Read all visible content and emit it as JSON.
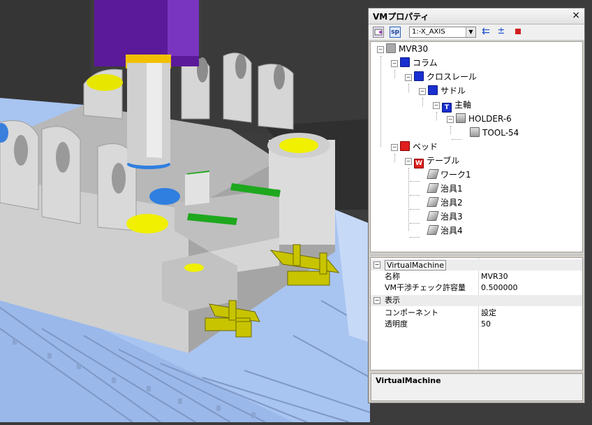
{
  "panel": {
    "title": "VMプロパティ",
    "close_glyph": "×",
    "toolbar": {
      "btn_sp": "sp",
      "axis_selected": "1:-X_AXIS"
    }
  },
  "tree": {
    "nodes": [
      {
        "label": "MVR30",
        "icon": "machine-icon"
      },
      {
        "label": "コラム",
        "icon": "component-icon"
      },
      {
        "label": "クロスレール",
        "icon": "component-icon"
      },
      {
        "label": "サドル",
        "icon": "component-icon"
      },
      {
        "label": "主軸",
        "icon": "spindle-t-icon",
        "badge": "T"
      },
      {
        "label": "HOLDER-6",
        "icon": "holder-icon"
      },
      {
        "label": "TOOL-54",
        "icon": "tool-icon"
      },
      {
        "label": "ベッド",
        "icon": "bed-icon"
      },
      {
        "label": "テーブル",
        "icon": "table-w-icon",
        "badge": "W"
      },
      {
        "label": "ワーク1",
        "icon": "workpiece-icon"
      },
      {
        "label": "治具1",
        "icon": "fixture-icon"
      },
      {
        "label": "治具2",
        "icon": "fixture-icon"
      },
      {
        "label": "治具3",
        "icon": "fixture-icon"
      },
      {
        "label": "治具4",
        "icon": "fixture-icon"
      }
    ]
  },
  "properties": {
    "categories": [
      {
        "name": "VirtualMachine",
        "rows": [
          {
            "key": "名称",
            "value": "MVR30"
          },
          {
            "key": "VM干渉チェック許容量",
            "value": "0.500000"
          }
        ]
      },
      {
        "name": "表示",
        "rows": [
          {
            "key": "コンポーネント",
            "value": "設定"
          },
          {
            "key": "透明度",
            "value": "50"
          }
        ]
      }
    ]
  },
  "description": {
    "title": "VirtualMachine"
  },
  "colors": {
    "panel_bg": "#d4d0c8",
    "spindle_purple": "#5a1a99",
    "bed_blue": "#a8c4f0",
    "yellow": "#f0f000",
    "gray_part": "#c4c4c4",
    "clamp_olive": "#c8c400",
    "green_strip": "#1ea81e"
  }
}
